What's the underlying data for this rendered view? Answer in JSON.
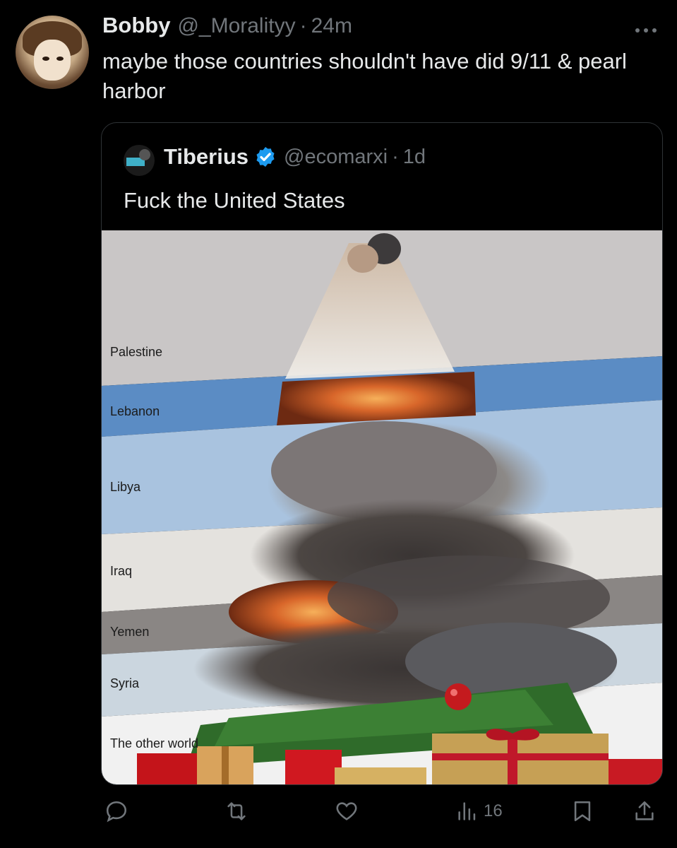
{
  "tweet": {
    "author_name": "Bobby",
    "author_handle": "@_Moralityy",
    "separator": "·",
    "time": "24m",
    "text": "maybe those countries shouldn't have did 9/11 & pearl harbor",
    "more_icon": "ellipsis-icon"
  },
  "quoted_tweet": {
    "author_name": "Tiberius",
    "verified": true,
    "author_handle": "@ecomarxi",
    "separator": "·",
    "time": "1d",
    "text": "Fuck the United States",
    "image": {
      "labels": [
        "Palestine",
        "Lebanon",
        "Libya",
        "Iraq",
        "Yemen",
        "Syria",
        "The other world"
      ]
    }
  },
  "actions": {
    "reply_icon": "reply-icon",
    "retweet_icon": "retweet-icon",
    "like_icon": "heart-icon",
    "views_icon": "views-icon",
    "views_count": "16",
    "bookmark_icon": "bookmark-icon",
    "share_icon": "share-icon"
  },
  "colors": {
    "background": "#000000",
    "text_primary": "#e7e9ea",
    "text_secondary": "#71767b",
    "verified_blue": "#1d9bf0",
    "border": "#2f3336"
  }
}
